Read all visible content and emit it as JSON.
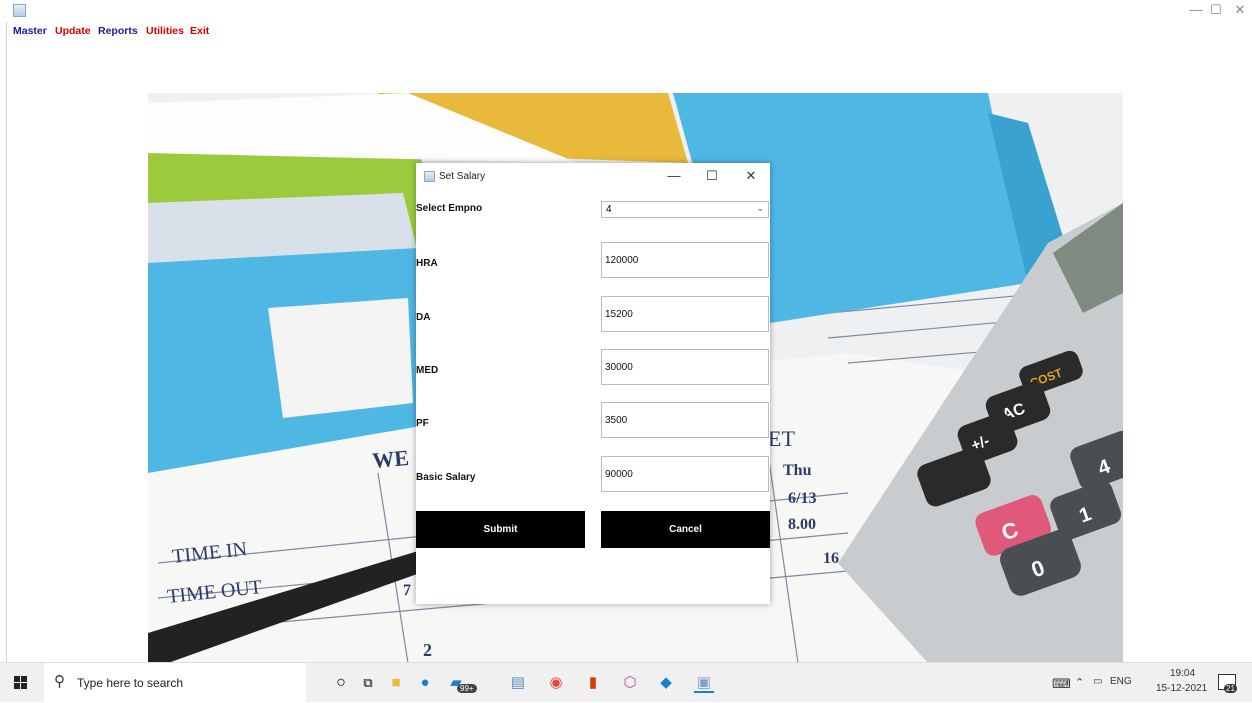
{
  "window": {
    "minimize_glyph": "—",
    "maximize_glyph": "☐",
    "close_glyph": "✕"
  },
  "menubar": {
    "items": [
      {
        "label": "Master",
        "color": "#1a1a9c"
      },
      {
        "label": "Update",
        "color": "#d40000"
      },
      {
        "label": "Reports",
        "color": "#1a1a9c"
      },
      {
        "label": "Utilities",
        "color": "#d40000"
      },
      {
        "label": "Exit",
        "color": "#d40000"
      }
    ]
  },
  "background": {
    "sheet_texts": [
      "TIME IN",
      "TIME OUT",
      "Thu",
      "6/13",
      "8.00",
      "16",
      "WE",
      "ET",
      "2",
      "7"
    ],
    "calculator_keys": [
      "COST",
      "AC",
      "+/-",
      "4",
      "1",
      "0",
      "C"
    ],
    "colors": {
      "blue_folder": "#4fb7e4",
      "green_folder": "#9bcb3c",
      "yellow_folder": "#e8b93a",
      "calc_body": "#c9cccf",
      "c_key": "#e0587a"
    }
  },
  "dialog": {
    "title": "Set Salary",
    "select_empno": {
      "label": "Select Empno",
      "value": "4"
    },
    "fields": [
      {
        "label": "HRA",
        "value": "120000"
      },
      {
        "label": "DA",
        "value": "15200"
      },
      {
        "label": "MED",
        "value": "30000"
      },
      {
        "label": "PF",
        "value": "3500"
      },
      {
        "label": "Basic Salary",
        "value": "90000"
      }
    ],
    "submit_label": "Submit",
    "cancel_label": "Cancel"
  },
  "taskbar": {
    "search_placeholder": "Type here to search",
    "apps": [
      "cortana-icon",
      "task-view-icon",
      "file-explorer-icon",
      "edge-icon",
      "photos-icon",
      "notepad-icon",
      "chrome-icon",
      "office-icon",
      "app-icon",
      "java-icon"
    ],
    "badge": "99+",
    "language": "ENG",
    "time": "19:04",
    "date": "15-12-2021",
    "notification_count": "21"
  }
}
